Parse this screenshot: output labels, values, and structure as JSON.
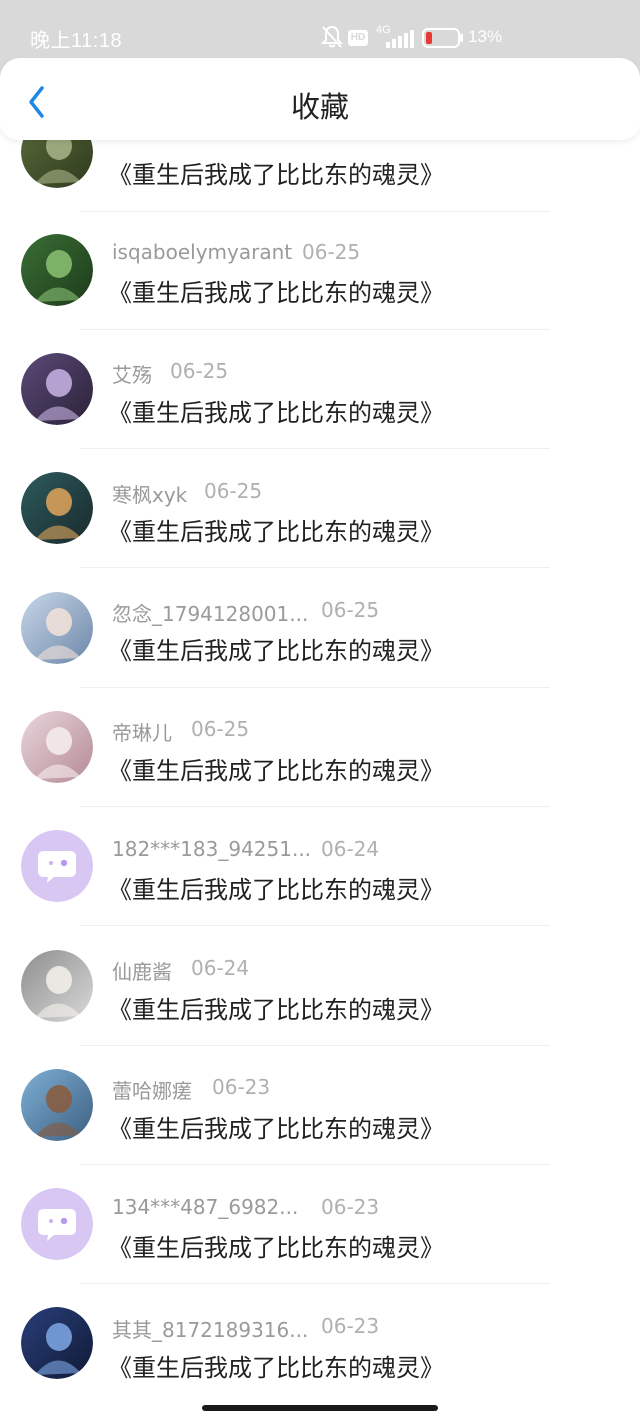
{
  "status_bar": {
    "time": "晚上11:18",
    "network": "4G",
    "hd": "HD",
    "battery": "13%"
  },
  "nav": {
    "title": "收藏"
  },
  "items": [
    {
      "user": "",
      "date": "",
      "title": "《重生后我成了比比东的魂灵》",
      "avatar": "photo-forest"
    },
    {
      "user": "isqaboelymyarant",
      "date": "06-25",
      "title": "《重生后我成了比比东的魂灵》",
      "avatar": "photo-plants"
    },
    {
      "user": "艾殇",
      "date": "06-25",
      "title": "《重生后我成了比比东的魂灵》",
      "avatar": "anime-purple"
    },
    {
      "user": "寒枫xyk",
      "date": "06-25",
      "title": "《重生后我成了比比东的魂灵》",
      "avatar": "anime-teal"
    },
    {
      "user": "忽念_1794128001...",
      "date": "06-25",
      "title": "《重生后我成了比比东的魂灵》",
      "avatar": "photo-girl"
    },
    {
      "user": "帝琳儿",
      "date": "06-25",
      "title": "《重生后我成了比比东的魂灵》",
      "avatar": "photo-pink"
    },
    {
      "user": "182***183_94251...",
      "date": "06-24",
      "title": "《重生后我成了比比东的魂灵》",
      "avatar": "default-chat"
    },
    {
      "user": "仙鹿酱",
      "date": "06-24",
      "title": "《重生后我成了比比东的魂灵》",
      "avatar": "anime-white"
    },
    {
      "user": "蕾哈娜瘥",
      "date": "06-23",
      "title": "《重生后我成了比比东的魂灵》",
      "avatar": "photo-beach"
    },
    {
      "user": "134***487_6982...",
      "date": "06-23",
      "title": "《重生后我成了比比东的魂灵》",
      "avatar": "default-chat"
    },
    {
      "user": "其其_8172189316...",
      "date": "06-23",
      "title": "《重生后我成了比比东的魂灵》",
      "avatar": "anime-blue"
    }
  ],
  "colors": {
    "accent": "#1e88e5",
    "default_avatar": "#d8c6f3"
  }
}
